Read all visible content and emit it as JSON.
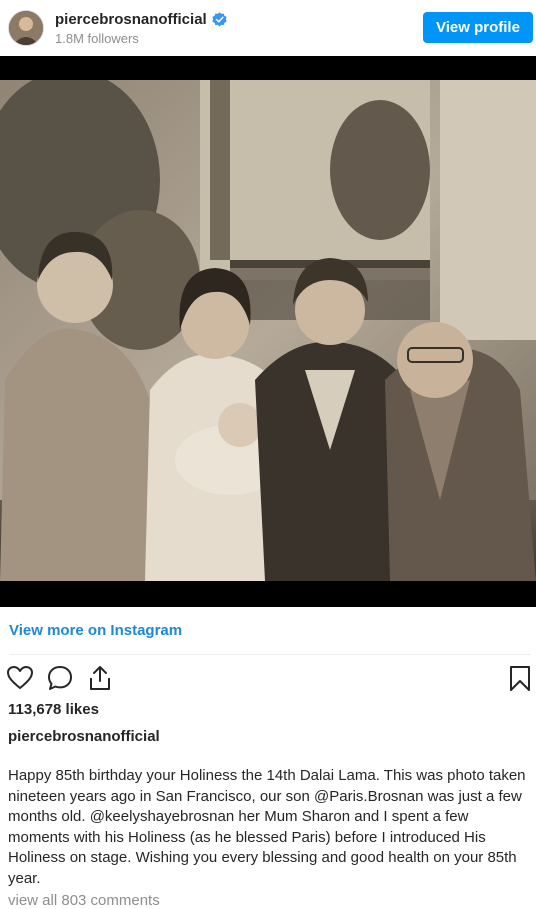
{
  "header": {
    "username": "piercebrosnanofficial",
    "followers": "1.8M followers",
    "view_profile_label": "View profile",
    "verified_icon": "verified-badge-icon"
  },
  "post": {
    "view_more_label": "View more on Instagram",
    "likes": "113,678 likes",
    "caption_username": "piercebrosnanofficial",
    "caption": "Happy 85th birthday your Holiness the 14th Dalai Lama. This was photo taken nineteen years ago in San Francisco, our son @Paris.Brosnan was just a few months old. @keelyshayebrosnan her Mum Sharon and I spent a few moments with his Holiness (as he blessed Paris) before I introduced His Holiness on stage. Wishing you every blessing and good health on your 85th year.",
    "comments_label": "view all 803 comments"
  },
  "actions": {
    "icons": [
      "heart-icon",
      "comment-icon",
      "share-icon",
      "bookmark-icon"
    ]
  },
  "colors": {
    "accent": "#0095f6",
    "link": "#1e88d8",
    "muted": "#8e8e8e",
    "text": "#262626"
  }
}
